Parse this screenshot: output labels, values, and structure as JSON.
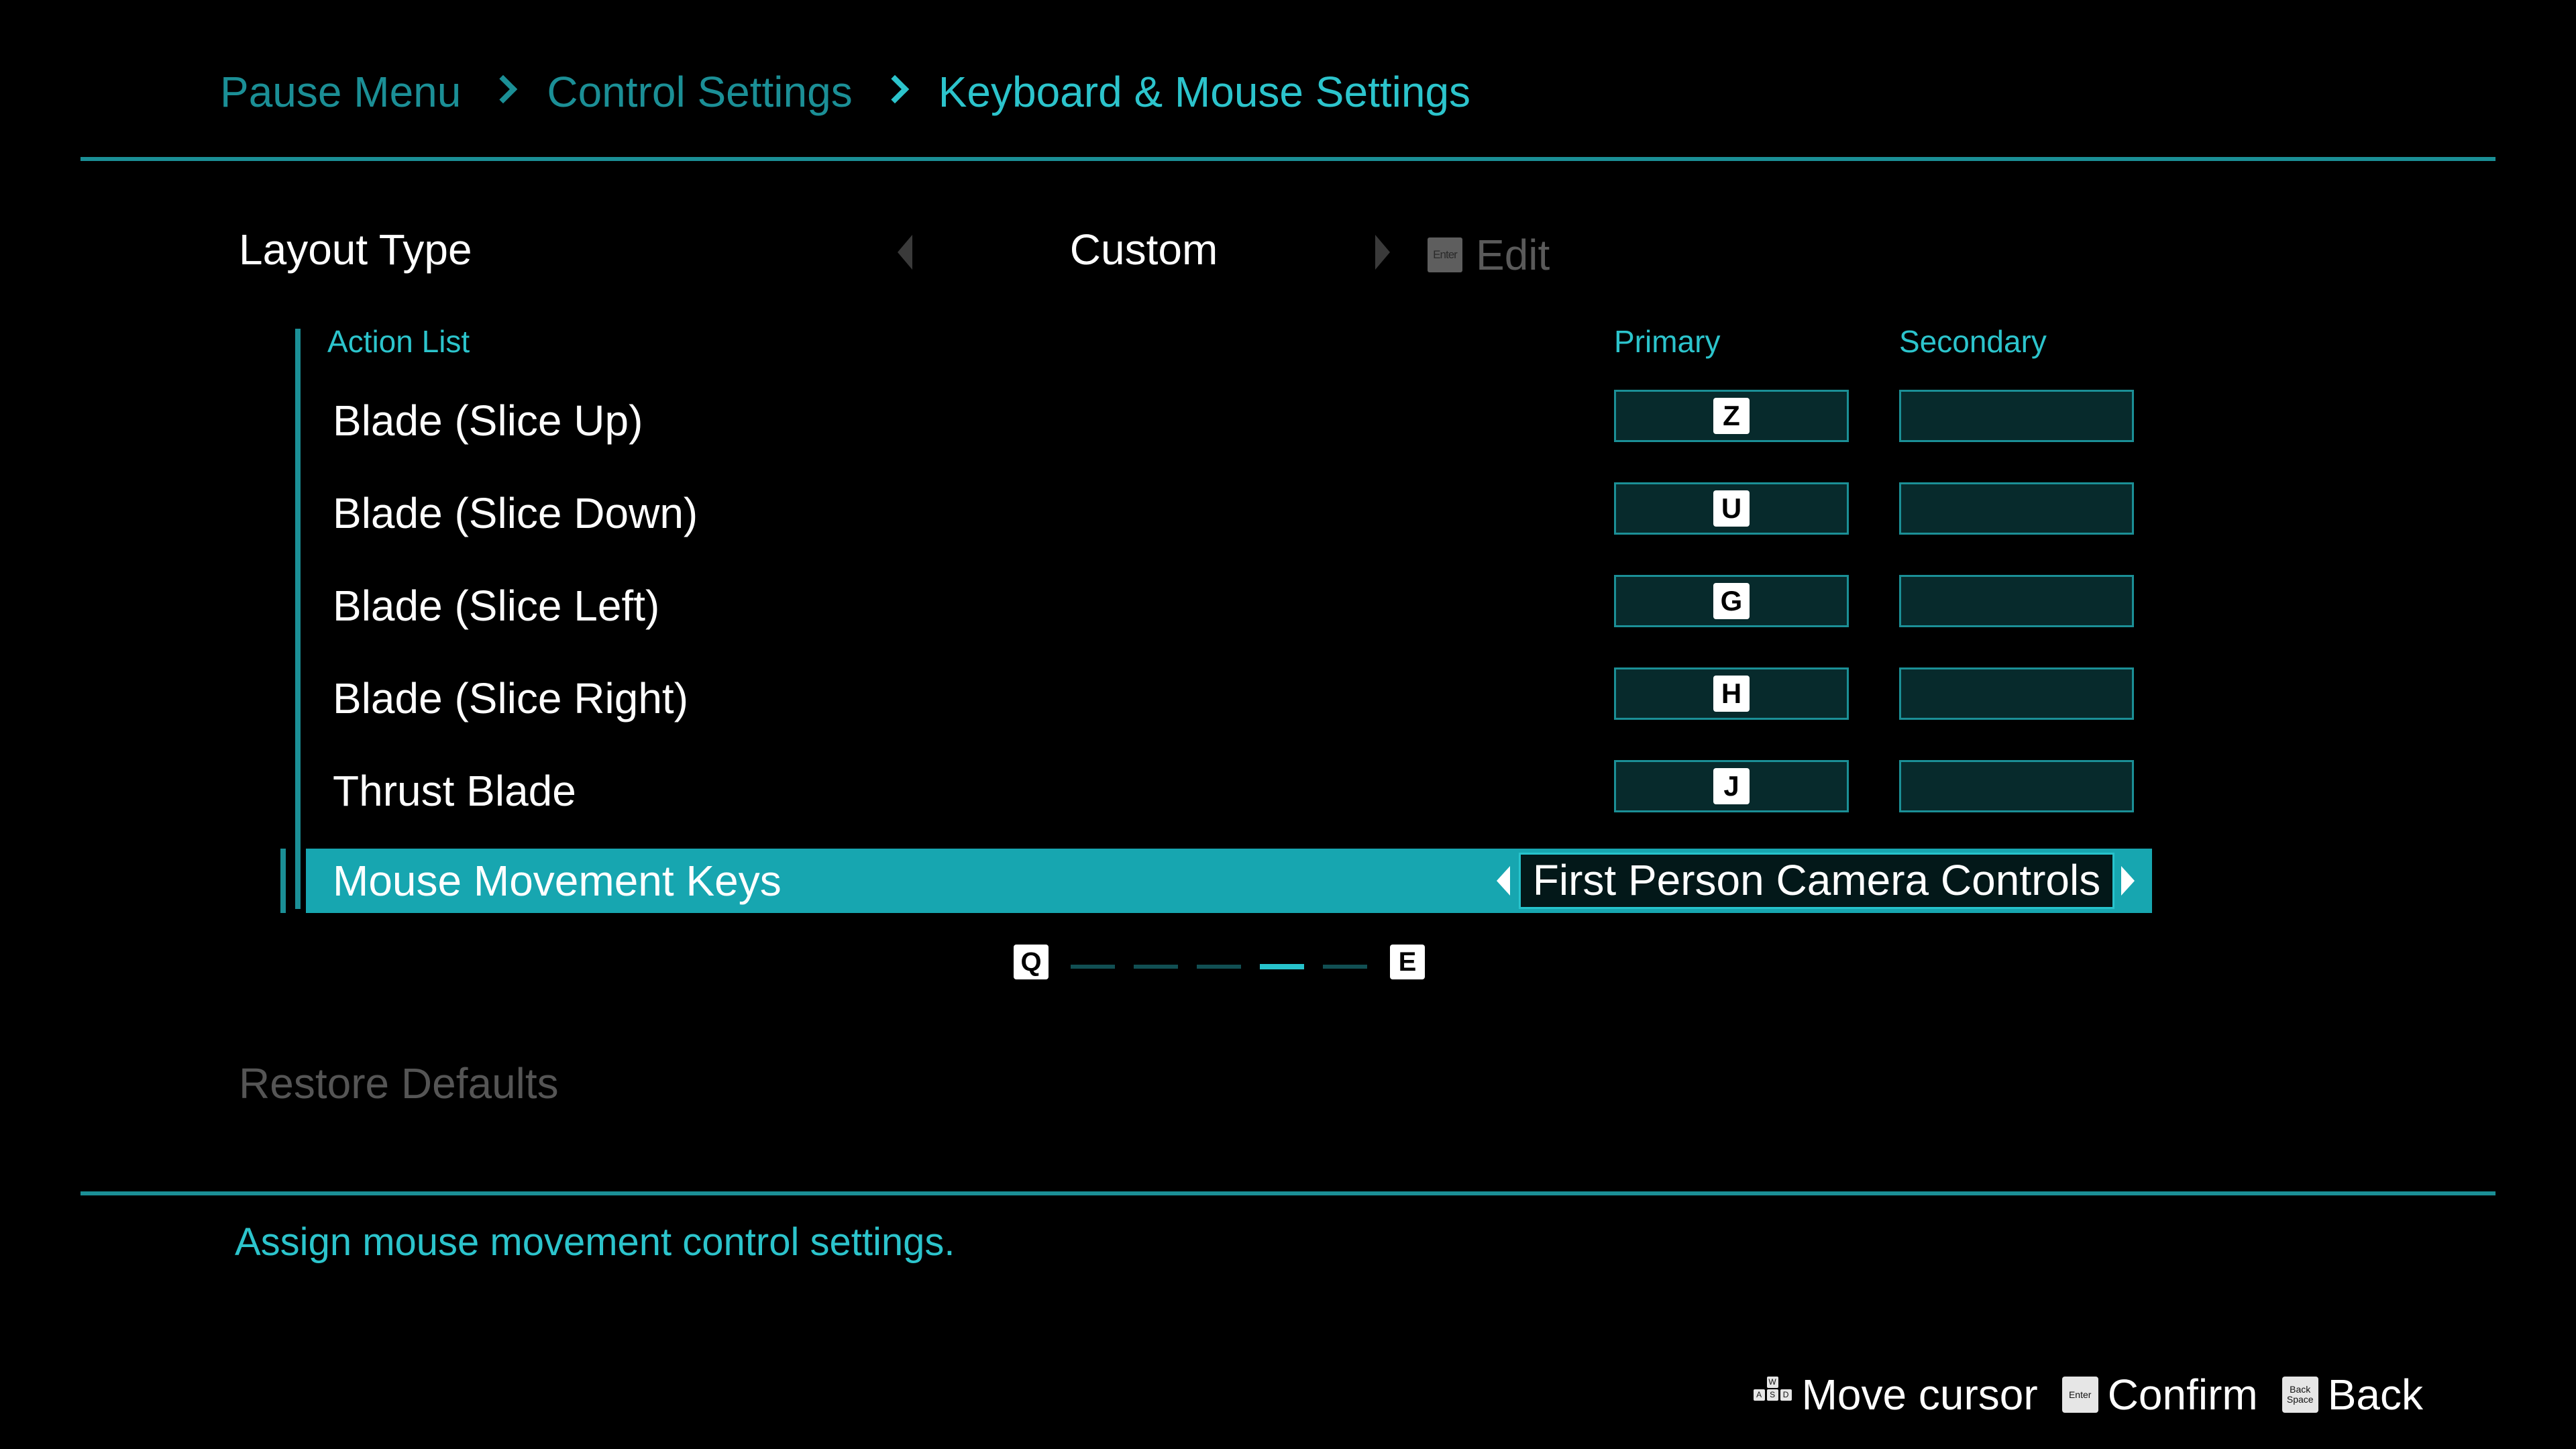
{
  "breadcrumb": {
    "items": [
      "Pause Menu",
      "Control Settings",
      "Keyboard & Mouse Settings"
    ]
  },
  "layout_type": {
    "label": "Layout Type",
    "value": "Custom",
    "edit_key": "Enter",
    "edit_label": "Edit"
  },
  "action_list": {
    "header": "Action List",
    "primary_header": "Primary",
    "secondary_header": "Secondary",
    "rows": [
      {
        "label": "Blade (Slice Up)",
        "primary": "Z",
        "secondary": ""
      },
      {
        "label": "Blade (Slice Down)",
        "primary": "U",
        "secondary": ""
      },
      {
        "label": "Blade (Slice Left)",
        "primary": "G",
        "secondary": ""
      },
      {
        "label": "Blade (Slice Right)",
        "primary": "H",
        "secondary": ""
      },
      {
        "label": "Thrust Blade",
        "primary": "J",
        "secondary": ""
      }
    ],
    "selected": {
      "label": "Mouse Movement Keys",
      "value": "First Person Camera Controls"
    }
  },
  "pager": {
    "prev_key": "Q",
    "next_key": "E",
    "pages": 5,
    "current_page": 4
  },
  "restore_defaults": "Restore Defaults",
  "help_text": "Assign mouse movement control settings.",
  "hints": {
    "move": {
      "keys": [
        "W",
        "A",
        "S",
        "D"
      ],
      "label": "Move cursor"
    },
    "confirm": {
      "key": "Enter",
      "label": "Confirm"
    },
    "back": {
      "key_line1": "Back",
      "key_line2": "Space",
      "label": "Back"
    }
  },
  "colors": {
    "accent": "#2cc4cc",
    "accent_dim": "#1b8f96",
    "selection": "#17a6b0",
    "background": "#000000"
  }
}
